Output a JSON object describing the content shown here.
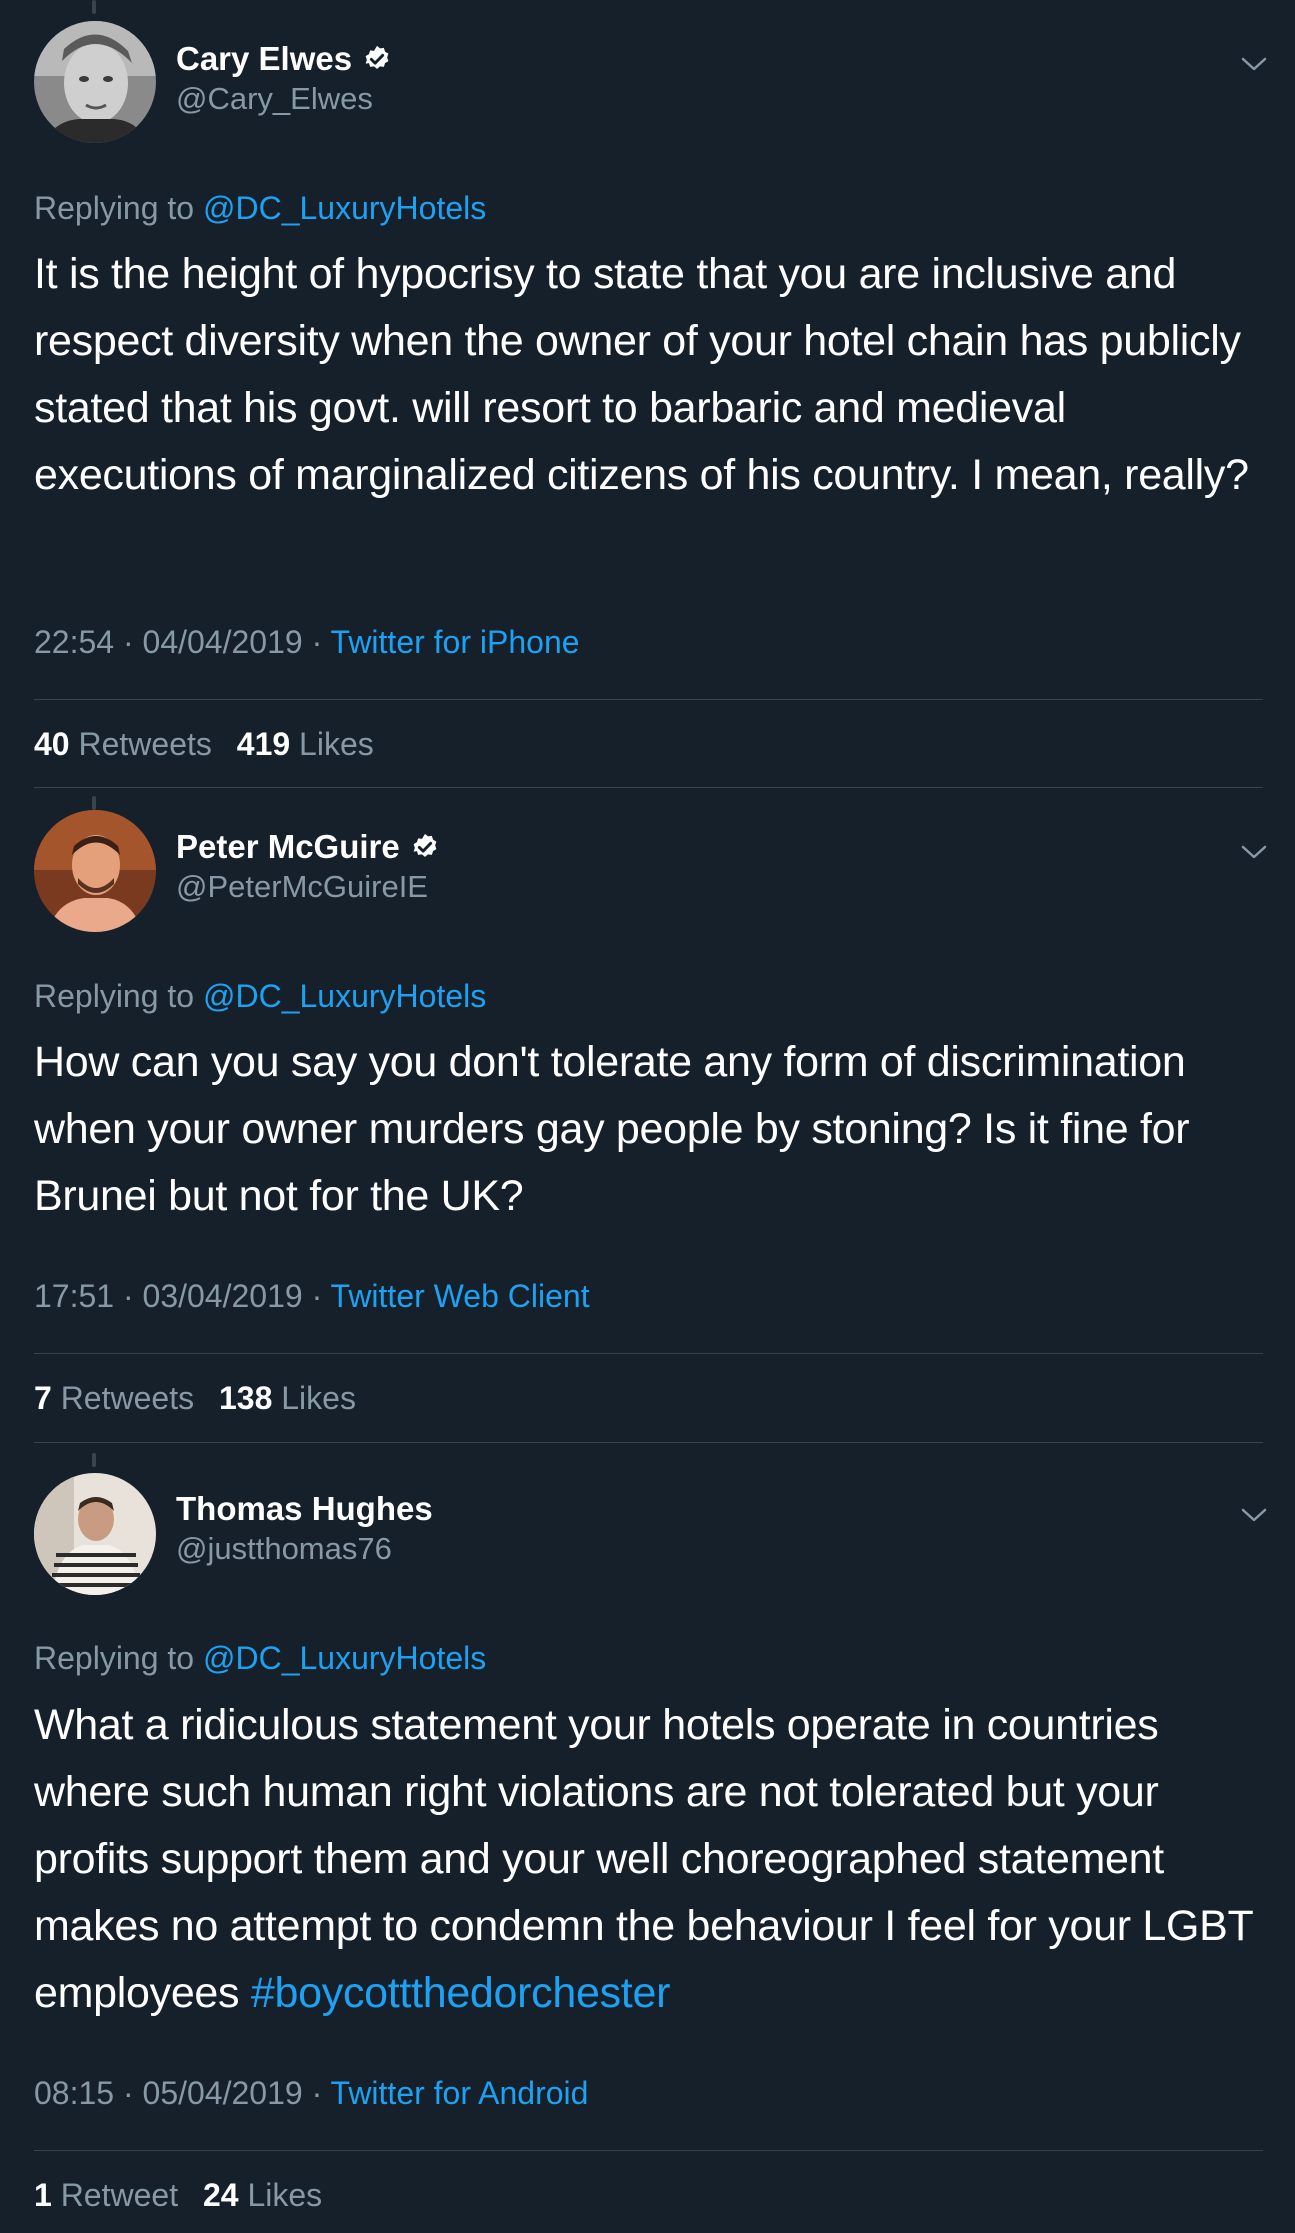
{
  "colors": {
    "background": "#15202b",
    "text_primary": "#ffffff",
    "text_secondary": "#8899a6",
    "link": "#1da1f2",
    "divider": "#38444d"
  },
  "tweets": [
    {
      "display_name": "Cary Elwes",
      "verified": true,
      "handle": "@Cary_Elwes",
      "replying_prefix": "Replying to",
      "replying_to": "@DC_LuxuryHotels",
      "text": "It is the height of hypocrisy to state that you are inclusive and respect diversity when the owner of your hotel chain has publicly stated that his govt. will resort to barbaric and medieval executions of marginalized citizens of his country. I mean, really?",
      "hashtag": "",
      "timestamp": "22:54 · 04/04/2019 · ",
      "source": "Twitter for iPhone",
      "retweets_count": "40",
      "retweets_label": "Retweets",
      "likes_count": "419",
      "likes_label": "Likes",
      "avatar_icon": "avatar-photo-icon"
    },
    {
      "display_name": "Peter McGuire",
      "verified": true,
      "handle": "@PeterMcGuireIE",
      "replying_prefix": "Replying to",
      "replying_to": "@DC_LuxuryHotels",
      "text": "How can you say you don't tolerate any form of discrimination when your owner murders gay people by stoning? Is it fine for Brunei but not for the UK?",
      "hashtag": "",
      "timestamp": "17:51 · 03/04/2019 · ",
      "source": "Twitter Web Client",
      "retweets_count": "7",
      "retweets_label": "Retweets",
      "likes_count": "138",
      "likes_label": "Likes",
      "avatar_icon": "avatar-photo-icon"
    },
    {
      "display_name": "Thomas Hughes",
      "verified": false,
      "handle": "@justthomas76",
      "replying_prefix": "Replying to",
      "replying_to": "@DC_LuxuryHotels",
      "text": "What a ridiculous statement your hotels operate in countries where such human right violations are not tolerated but your profits support them and your well choreographed statement makes no attempt to condemn the behaviour I feel for your LGBT employees ",
      "hashtag": "#boycottthedorchester",
      "timestamp": "08:15 · 05/04/2019 · ",
      "source": "Twitter for Android",
      "retweets_count": "1",
      "retweets_label": "Retweet",
      "likes_count": "24",
      "likes_label": "Likes",
      "avatar_icon": "avatar-photo-icon"
    }
  ]
}
